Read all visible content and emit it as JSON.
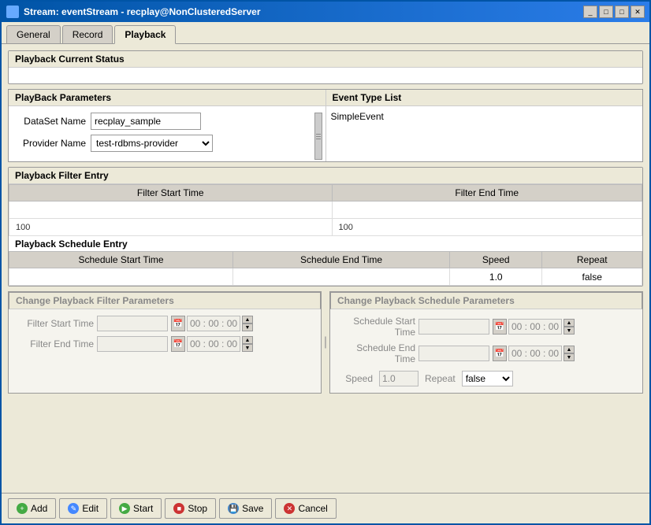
{
  "window": {
    "title": "Stream: eventStream - recplay@NonClusteredServer"
  },
  "tabs": [
    {
      "label": "General",
      "active": false
    },
    {
      "label": "Record",
      "active": false
    },
    {
      "label": "Playback",
      "active": true
    }
  ],
  "sections": {
    "playback_status": {
      "title": "Playback Current Status"
    },
    "playback_params": {
      "title": "PlayBack Parameters",
      "fields": {
        "dataset_label": "DataSet Name",
        "dataset_value": "recplay_sample",
        "provider_label": "Provider Name",
        "provider_value": "test-rdbms-provider"
      }
    },
    "event_type": {
      "title": "Event Type List",
      "items": [
        "SimpleEvent"
      ]
    },
    "filter_entry": {
      "title": "Playback Filter Entry",
      "columns": [
        "Filter Start Time",
        "Filter End Time"
      ],
      "rows": [
        {
          "start": "",
          "end": ""
        },
        {
          "start": "100",
          "end": "100"
        }
      ]
    },
    "schedule_entry": {
      "title": "Playback Schedule Entry",
      "columns": [
        "Schedule Start Time",
        "Schedule End Time",
        "Speed",
        "Repeat"
      ],
      "rows": [
        {
          "start": "",
          "end": "",
          "speed": "1.0",
          "repeat": "false"
        }
      ]
    },
    "change_filter": {
      "title": "Change Playback Filter Parameters",
      "filter_start_label": "Filter Start Time",
      "filter_end_label": "Filter End Time",
      "time_placeholder": "00 : 00 : 00"
    },
    "change_schedule": {
      "title": "Change Playback Schedule Parameters",
      "start_label": "Schedule Start Time",
      "end_label": "Schedule End Time",
      "speed_label": "Speed",
      "speed_value": "1.0",
      "repeat_label": "Repeat",
      "repeat_value": "false",
      "time_placeholder": "00 : 00 : 00"
    }
  },
  "buttons": {
    "add": "Add",
    "edit": "Edit",
    "start": "Start",
    "stop": "Stop",
    "save": "Save",
    "cancel": "Cancel"
  }
}
